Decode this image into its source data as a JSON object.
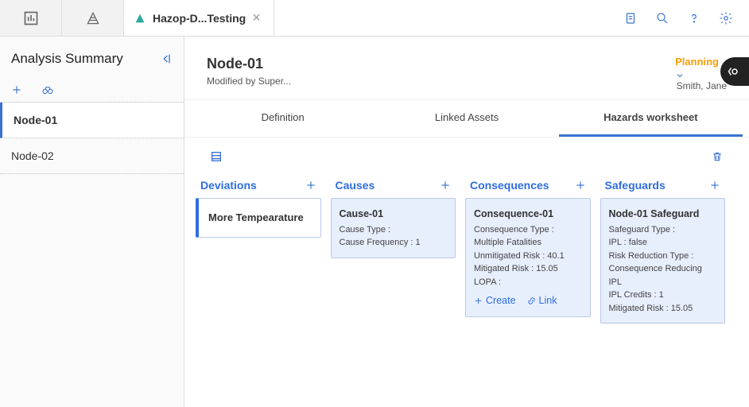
{
  "topbar": {
    "tab_label": "Hazop-D...Testing",
    "close_glyph": "×"
  },
  "sidebar": {
    "title": "Analysis Summary",
    "items": [
      {
        "label": "Node-01"
      },
      {
        "label": "Node-02"
      }
    ]
  },
  "node": {
    "title": "Node-01",
    "subtitle": "Modified by Super...",
    "status": "Planning",
    "owner": "Smith, Jane"
  },
  "tabs": [
    {
      "label": "Definition"
    },
    {
      "label": "Linked Assets"
    },
    {
      "label": "Hazards worksheet"
    }
  ],
  "columns": {
    "deviations": {
      "title": "Deviations",
      "card": {
        "label": "More Tempearature"
      }
    },
    "causes": {
      "title": "Causes",
      "card": {
        "title": "Cause-01",
        "line1": "Cause Type :",
        "line2": "Cause Frequency : 1"
      }
    },
    "consequences": {
      "title": "Consequences",
      "card": {
        "title": "Consequence-01",
        "line1": "Consequence Type : Multiple Fatalities",
        "line2": "Unmitigated Risk : 40.1",
        "line3": "Mitigated Risk : 15.05",
        "line4": "LOPA :",
        "action_create": "Create",
        "action_link": "Link"
      }
    },
    "safeguards": {
      "title": "Safeguards",
      "card": {
        "title": "Node-01 Safeguard",
        "line1": "Safeguard Type :",
        "line2": "IPL : false",
        "line3": "Risk Reduction Type : Consequence Reducing IPL",
        "line4": "IPL Credits : 1",
        "line5": "Mitigated Risk : 15.05"
      }
    }
  }
}
